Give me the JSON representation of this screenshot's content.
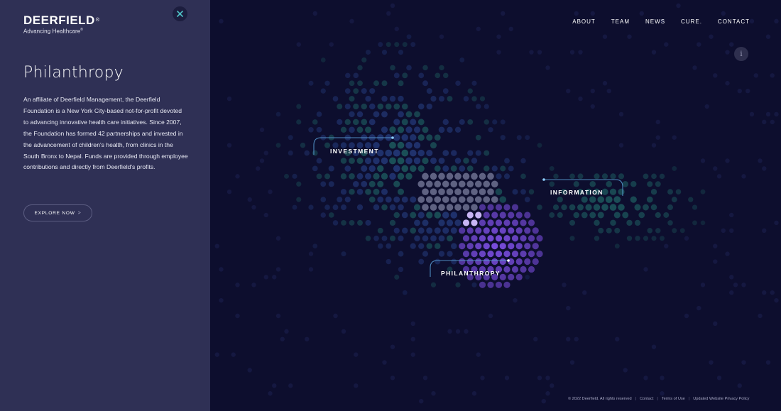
{
  "brand": {
    "name": "DEERFIELD",
    "tagline": "Advancing Healthcare",
    "mark": "®"
  },
  "panel": {
    "title": "Philanthropy",
    "body": "An affiliate of Deerfield Management, the Deerfield Foundation is a New York City-based not-for-profit devoted to advancing innovative health care initiatives. Since 2007, the Foundation has formed 42 partnerships and invested in the advancement of children's health, from clinics in the South Bronx to Nepal. Funds are provided through employee contributions and directly from Deerfield's profits.",
    "cta_label": "EXPLORE NOW",
    "cta_chevron": ">",
    "close_icon": "close-icon"
  },
  "nav": {
    "items": [
      "ABOUT",
      "TEAM",
      "NEWS",
      "CURE.",
      "CONTACT"
    ]
  },
  "info_button": {
    "label": "i"
  },
  "viz": {
    "labels": {
      "investment": "INVESTMENT",
      "information": "INFORMATION",
      "philanthropy": "PHILANTHROPY"
    },
    "colors": {
      "background": "#0d0e2e",
      "faint_dot": "#1a1c4a",
      "blue_dot": "#243a7a",
      "teal_dot": "#1d5a5e",
      "gray_dot": "#6e7190",
      "purple_dot": "#7b4ee0",
      "light_purple_dot": "#c8b6f5",
      "connector": "#5aa0d8"
    }
  },
  "footer": {
    "copyright": "© 2022 Deerfield. All rights reserved",
    "links": [
      "Contact",
      "Terms of Use",
      "Updated Website Privacy Policy"
    ],
    "separator": "|"
  },
  "colors": {
    "panel_bg": "#2f3055",
    "page_bg": "#0d0e2e",
    "accent_teal": "#4fc3c7"
  }
}
